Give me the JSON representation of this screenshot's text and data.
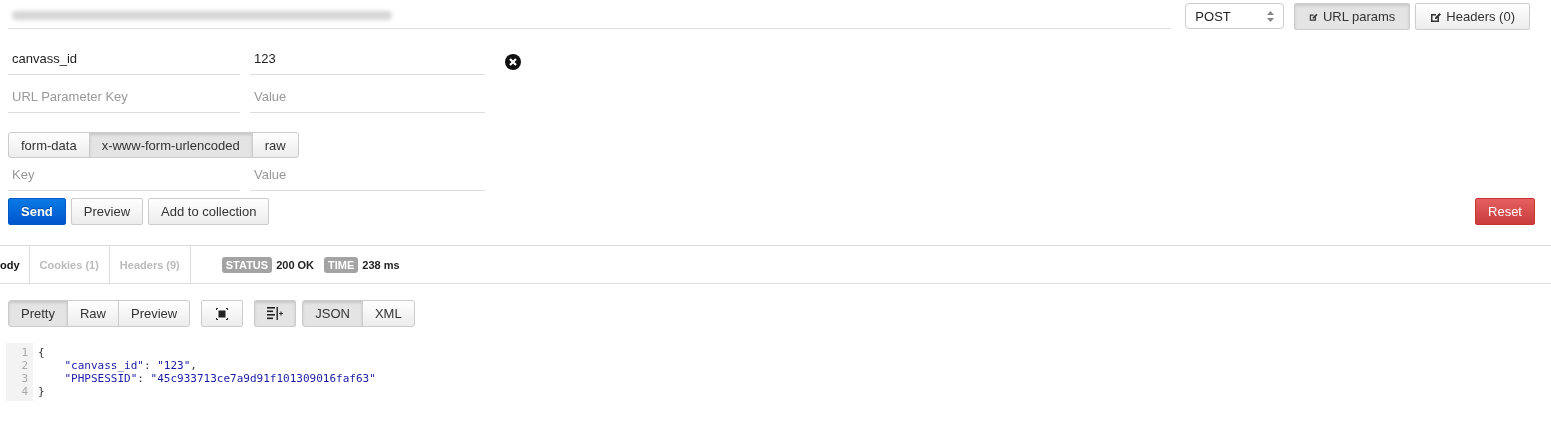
{
  "request": {
    "url_field": {
      "blurred": true
    },
    "method": "POST",
    "toggles": [
      {
        "label": "URL params",
        "selected": true
      },
      {
        "label": "Headers (0)",
        "selected": false
      }
    ]
  },
  "url_params": [
    {
      "key": "canvass_id",
      "value": "123",
      "removable": true
    },
    {
      "key_placeholder": "URL Parameter Key",
      "value_placeholder": "Value",
      "removable": false
    }
  ],
  "body_modes": [
    {
      "label": "form-data",
      "selected": false
    },
    {
      "label": "x-www-form-urlencoded",
      "selected": true
    },
    {
      "label": "raw",
      "selected": false
    }
  ],
  "body_fields": [
    {
      "key_placeholder": "Key",
      "value_placeholder": "Value"
    }
  ],
  "actions": [
    {
      "label": "Send",
      "kind": "primary"
    },
    {
      "label": "Preview",
      "kind": "default"
    },
    {
      "label": "Add to collection",
      "kind": "default"
    },
    {
      "label": "Reset",
      "kind": "danger"
    }
  ],
  "response_tabs": [
    {
      "label": "ody",
      "selected": true
    },
    {
      "label": "Cookies (1)",
      "selected": false
    },
    {
      "label": "Headers (9)",
      "selected": false
    }
  ],
  "status": [
    {
      "label": "STATUS",
      "value": "200 OK"
    },
    {
      "label": "TIME",
      "value": "238 ms"
    }
  ],
  "view_modes": [
    {
      "label": "Pretty",
      "selected": true
    },
    {
      "label": "Raw",
      "selected": false
    },
    {
      "label": "Preview",
      "selected": false
    }
  ],
  "tools": [
    {
      "kind": "expand",
      "selected": false
    },
    {
      "kind": "wrap",
      "selected": true
    }
  ],
  "formats": [
    {
      "label": "JSON",
      "selected": true
    },
    {
      "label": "XML",
      "selected": false
    }
  ],
  "code": [
    {
      "number": "1",
      "tokens": [
        {
          "kind": "punct",
          "text": "{"
        }
      ]
    },
    {
      "number": "2",
      "indent": true,
      "tokens": [
        {
          "kind": "key",
          "text": "\"canvass_id\""
        },
        {
          "kind": "punct",
          "text": ": "
        },
        {
          "kind": "string",
          "text": "\"123\""
        },
        {
          "kind": "punct",
          "text": ","
        }
      ]
    },
    {
      "number": "3",
      "indent": true,
      "tokens": [
        {
          "kind": "key",
          "text": "\"PHPSESSID\""
        },
        {
          "kind": "punct",
          "text": ": "
        },
        {
          "kind": "string",
          "text": "\"45c933713ce7a9d91f101309016faf63\""
        }
      ]
    },
    {
      "number": "4",
      "tokens": [
        {
          "kind": "punct",
          "text": "}"
        }
      ]
    }
  ]
}
